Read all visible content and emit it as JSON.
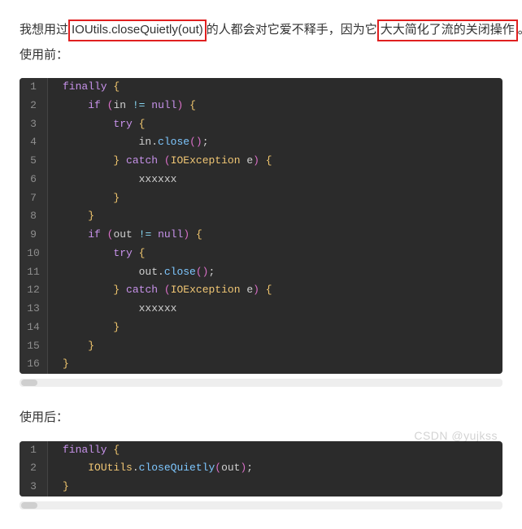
{
  "intro": {
    "before1": "我想用过",
    "hl1": "IOUtils.closeQuietly(out)",
    "mid": "的人都会对它爱不释手，因为它",
    "hl2": "大大简化了流的关闭操作",
    "after": "。"
  },
  "labels": {
    "before": "使用前：",
    "after": "使用后："
  },
  "code_before": [
    {
      "indent": 0,
      "raw": "finally {"
    },
    {
      "indent": 2,
      "raw": "if (in != null) {"
    },
    {
      "indent": 4,
      "raw": "try {"
    },
    {
      "indent": 6,
      "raw": "in.close();"
    },
    {
      "indent": 4,
      "raw": "} catch (IOException e) {"
    },
    {
      "indent": 6,
      "raw": "xxxxxx"
    },
    {
      "indent": 4,
      "raw": "}"
    },
    {
      "indent": 2,
      "raw": "}"
    },
    {
      "indent": 2,
      "raw": "if (out != null) {"
    },
    {
      "indent": 4,
      "raw": "try {"
    },
    {
      "indent": 6,
      "raw": "out.close();"
    },
    {
      "indent": 4,
      "raw": "} catch (IOException e) {"
    },
    {
      "indent": 6,
      "raw": "xxxxxx"
    },
    {
      "indent": 4,
      "raw": "}"
    },
    {
      "indent": 2,
      "raw": "}"
    },
    {
      "indent": 0,
      "raw": "}"
    }
  ],
  "code_after": [
    {
      "indent": 0,
      "raw": "finally {"
    },
    {
      "indent": 2,
      "raw": "IOUtils.closeQuietly(out);"
    },
    {
      "indent": 0,
      "raw": "}"
    }
  ],
  "watermark": "CSDN @yujkss"
}
